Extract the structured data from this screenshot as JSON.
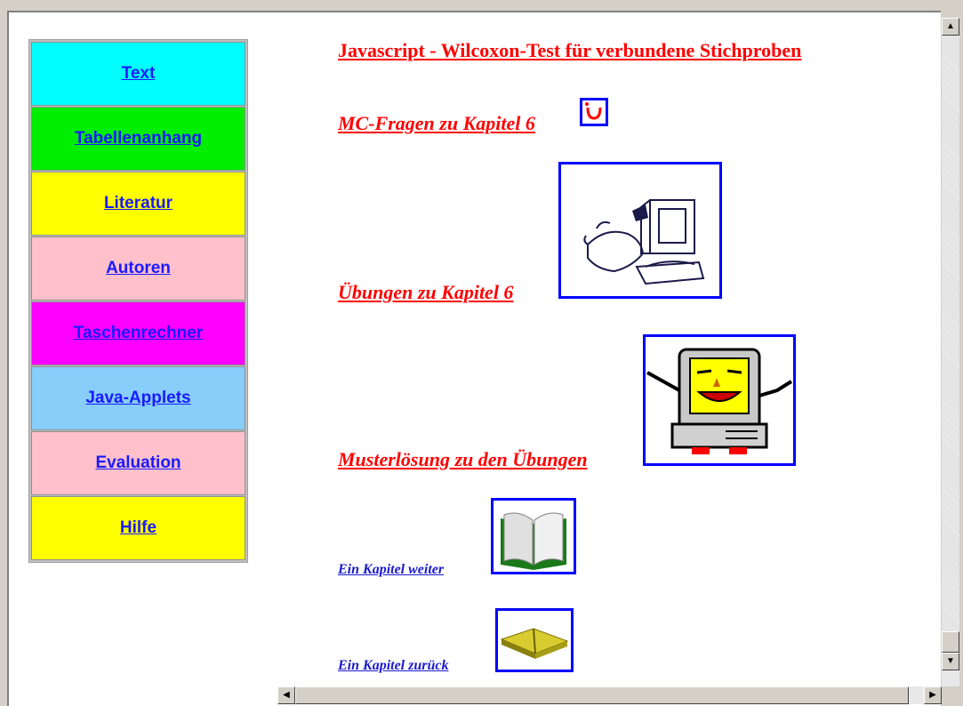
{
  "nav": {
    "items": [
      {
        "label": "Text",
        "color": "#00ffff"
      },
      {
        "label": "Tabellenanhang",
        "color": "#00ee00"
      },
      {
        "label": "Literatur",
        "color": "#ffff00"
      },
      {
        "label": "Autoren",
        "color": "#ffc0cb"
      },
      {
        "label": "Taschenrechner",
        "color": "#ff00ff"
      },
      {
        "label": "Java-Applets",
        "color": "#87cefa"
      },
      {
        "label": "Evaluation",
        "color": "#ffc0cb"
      },
      {
        "label": "Hilfe",
        "color": "#ffff00"
      }
    ]
  },
  "content": {
    "title": "Javascript - Wilcoxon-Test für verbundene Stichproben",
    "mc_link": "MC-Fragen zu Kapitel 6",
    "exercises_link": "Übungen zu Kapitel 6",
    "solution_link": "Musterlösung zu den Übungen",
    "next_link": "Ein Kapitel weiter",
    "prev_link": "Ein Kapitel zurück"
  },
  "icons": {
    "mc": "mc-question-icon",
    "exercises": "computer-hand-icon",
    "solution": "smiling-computer-icon",
    "next": "open-book-icon",
    "prev": "closed-book-icon"
  },
  "colors": {
    "link_red": "#ff0000",
    "link_blue": "#1a1acc",
    "nav_link": "#1a1aff",
    "image_border": "#0000ff"
  }
}
